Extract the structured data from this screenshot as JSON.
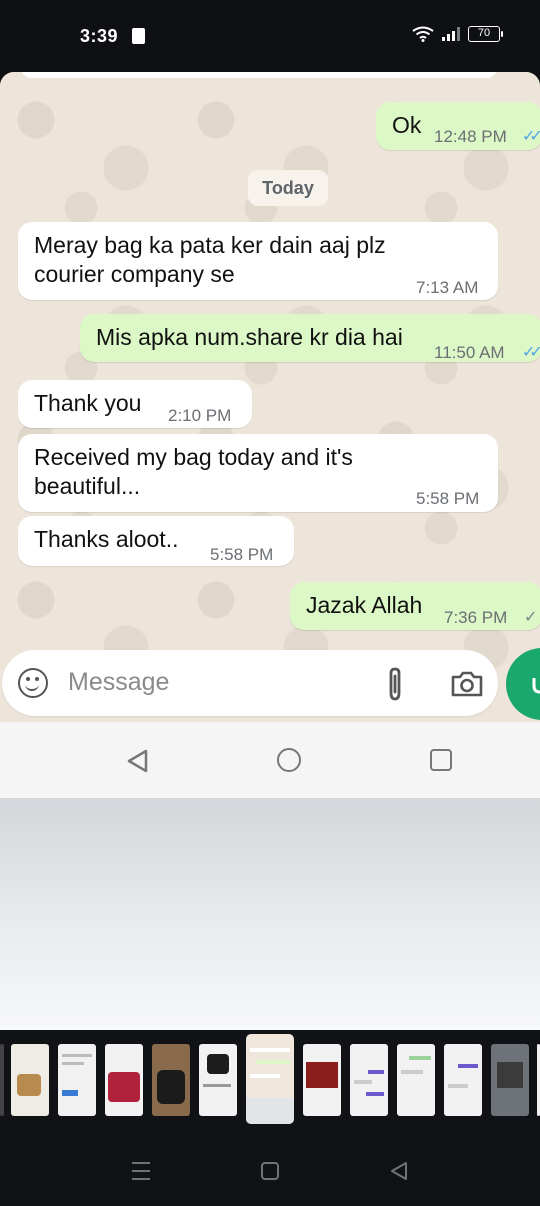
{
  "status_bar": {
    "time": "3:39",
    "battery": "70",
    "icons": [
      "app-notification-icon",
      "wifi-icon",
      "signal-icon",
      "battery-icon"
    ]
  },
  "chat": {
    "date_chip": "Today",
    "messages": [
      {
        "direction": "out",
        "text": "Ok",
        "time": "12:48 PM",
        "status": "read"
      },
      {
        "direction": "in",
        "line1": "Meray bag ka pata ker dain aaj plz",
        "line2": "courier company se",
        "time": "7:13 AM"
      },
      {
        "direction": "out",
        "text": "Mis apka num.share kr dia hai",
        "time": "11:50 AM",
        "status": "read"
      },
      {
        "direction": "in",
        "text": "Thank you",
        "time": "2:10 PM"
      },
      {
        "direction": "in",
        "line1": "Received my bag today and it's",
        "line2": "beautiful...",
        "time": "5:58 PM"
      },
      {
        "direction": "in",
        "text": "Thanks aloot..",
        "time": "5:58 PM"
      },
      {
        "direction": "out",
        "text": "Jazak Allah",
        "time": "7:36 PM",
        "status": "delivered"
      }
    ],
    "colors": {
      "incoming": "#ffffff",
      "outgoing": "#dcf8c6",
      "read_tick": "#53a6e8",
      "mic": "#1aa86e"
    }
  },
  "input": {
    "placeholder": "Message",
    "icons": [
      "emoji-icon",
      "attach-icon",
      "camera-icon",
      "mic-icon"
    ]
  },
  "recents": {
    "thumbnail_count": 11,
    "selected_index": 5
  }
}
